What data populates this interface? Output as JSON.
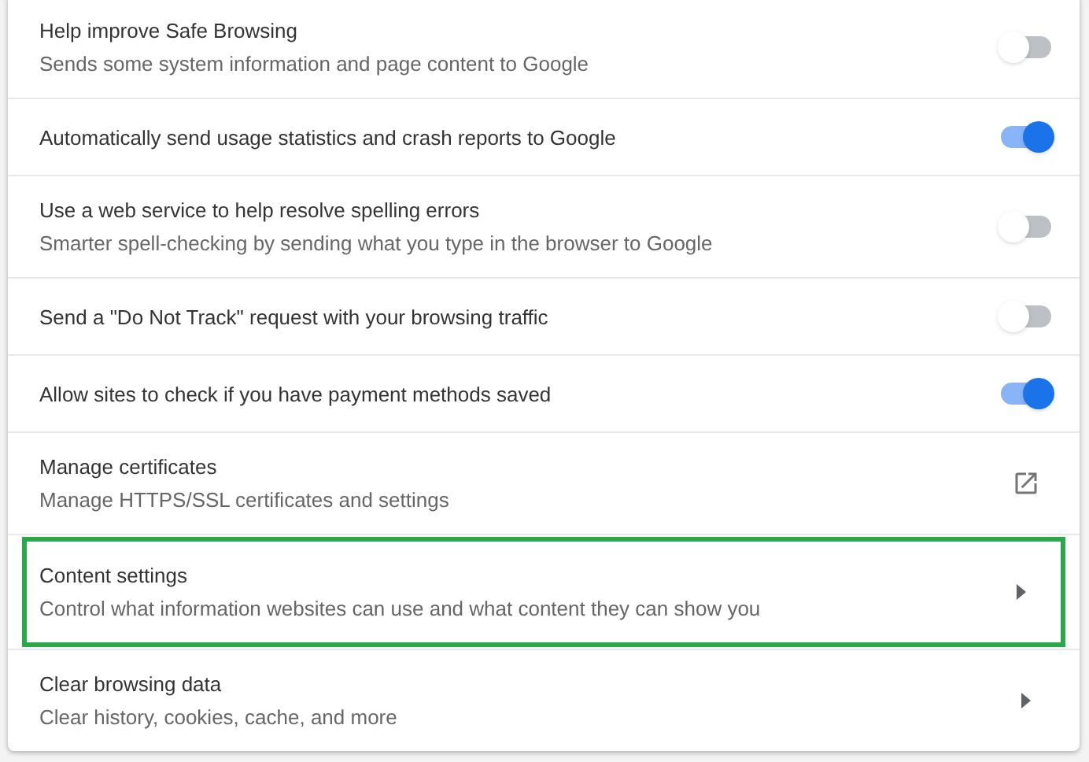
{
  "settings": [
    {
      "kind": "toggle",
      "title": "Help improve Safe Browsing",
      "subtitle": "Sends some system information and page content to Google",
      "on": false,
      "highlighted": false
    },
    {
      "kind": "toggle",
      "title": "Automatically send usage statistics and crash reports to Google",
      "on": true,
      "highlighted": false
    },
    {
      "kind": "toggle",
      "title": "Use a web service to help resolve spelling errors",
      "subtitle": "Smarter spell-checking by sending what you type in the browser to Google",
      "on": false,
      "highlighted": false
    },
    {
      "kind": "toggle",
      "title": "Send a \"Do Not Track\" request with your browsing traffic",
      "on": false,
      "highlighted": false
    },
    {
      "kind": "toggle",
      "title": "Allow sites to check if you have payment methods saved",
      "on": true,
      "highlighted": false
    },
    {
      "kind": "external",
      "title": "Manage certificates",
      "subtitle": "Manage HTTPS/SSL certificates and settings",
      "highlighted": false
    },
    {
      "kind": "arrow",
      "title": "Content settings",
      "subtitle": "Control what information websites can use and what content they can show you",
      "highlighted": true
    },
    {
      "kind": "arrow",
      "title": "Clear browsing data",
      "subtitle": "Clear history, cookies, cache, and more",
      "highlighted": false
    }
  ]
}
